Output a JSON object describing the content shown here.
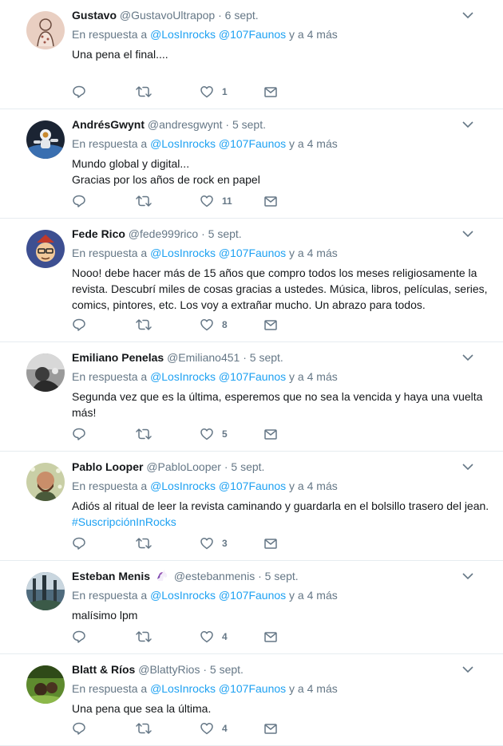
{
  "reply_prefix": "En respuesta a",
  "reply_joiner": "y a",
  "tweets": [
    {
      "name": "Gustavo",
      "handle": "@GustavoUltrapop",
      "time": "6 sept.",
      "mentions": [
        "@LosInrocks",
        "@107Faunos"
      ],
      "others": "4 más",
      "lines": [
        "Una pena el final...."
      ],
      "likes": "1",
      "avatar_icon": "sketch-avatar",
      "avatar_color": "#e9cfc2"
    },
    {
      "name": "AndrésGwynt",
      "handle": "@andresgwynt",
      "time": "5 sept.",
      "mentions": [
        "@LosInrocks",
        "@107Faunos"
      ],
      "others": "4 más",
      "lines": [
        "Mundo global y digital...",
        "Gracias por los años de rock en papel"
      ],
      "likes": "11",
      "avatar_icon": "astronaut-avatar",
      "avatar_color": "#1b2433"
    },
    {
      "name": "Fede Rico",
      "handle": "@fede999rico",
      "time": "5 sept.",
      "mentions": [
        "@LosInrocks",
        "@107Faunos"
      ],
      "others": "4 más",
      "lines": [
        "Nooo! debe hacer más de 15 años que compro todos los meses religiosamente la revista. Descubrí miles de cosas gracias a ustedes. Música, libros, películas, series, comics, pintores, etc. Los voy a extrañar mucho. Un abrazo para todos."
      ],
      "likes": "8",
      "avatar_icon": "cartoon-face-avatar",
      "avatar_color": "#3d4f91"
    },
    {
      "name": "Emiliano Penelas",
      "handle": "@Emiliano451",
      "time": "5 sept.",
      "mentions": [
        "@LosInrocks",
        "@107Faunos"
      ],
      "others": "4 más",
      "lines": [
        "Segunda vez que es la última, esperemos que no sea la vencida y haya una vuelta más!"
      ],
      "likes": "5",
      "avatar_icon": "bw-photo-avatar",
      "avatar_color": "#9a9a9a"
    },
    {
      "name": "Pablo Looper",
      "handle": "@PabloLooper",
      "time": "5 sept.",
      "mentions": [
        "@LosInrocks",
        "@107Faunos"
      ],
      "others": "4 más",
      "lines": [
        "Adiós al ritual de leer la revista caminando y guardarla en el bolsillo trasero del jean. "
      ],
      "hashtag": "#SuscripciónInRocks",
      "likes": "3",
      "avatar_icon": "bearded-man-avatar",
      "avatar_color": "#c9cfa6"
    },
    {
      "name": "Esteban Menis",
      "name_emoji": "unicorn-emoji",
      "handle": "@estebanmenis",
      "time": "5 sept.",
      "mentions": [
        "@LosInrocks",
        "@107Faunos"
      ],
      "others": "4 más",
      "lines": [
        "malísimo lpm"
      ],
      "likes": "4",
      "avatar_icon": "forest-photo-avatar",
      "avatar_color": "#4f6b7d"
    },
    {
      "name": "Blatt & Ríos",
      "handle": "@BlattyRios",
      "time": "5 sept.",
      "mentions": [
        "@LosInrocks",
        "@107Faunos"
      ],
      "others": "4 más",
      "lines": [
        "Una pena que sea la última."
      ],
      "likes": "4",
      "avatar_icon": "green-photo-avatar",
      "avatar_color": "#5e8a2e"
    }
  ]
}
